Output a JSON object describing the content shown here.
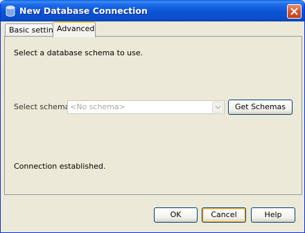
{
  "window": {
    "title": "New Database Connection",
    "icon": "database-icon",
    "close_icon": "close-icon"
  },
  "tabs": [
    {
      "label": "Basic setting",
      "selected": false
    },
    {
      "label": "Advanced",
      "selected": true
    }
  ],
  "panel": {
    "instruction": "Select a database schema to use.",
    "schema_label": "Select schema:",
    "schema_value": "<No schema>",
    "schema_enabled": false,
    "get_schemas_label": "Get Schemas",
    "status": "Connection established."
  },
  "footer": {
    "ok_label": "OK",
    "cancel_label": "Cancel",
    "help_label": "Help"
  },
  "colors": {
    "titlebar": "#0A53D3",
    "dialog_bg": "#ECE9D8",
    "button_border": "#003C74",
    "focus_ring": "#F9B84A",
    "disabled_text": "#ACA899"
  }
}
